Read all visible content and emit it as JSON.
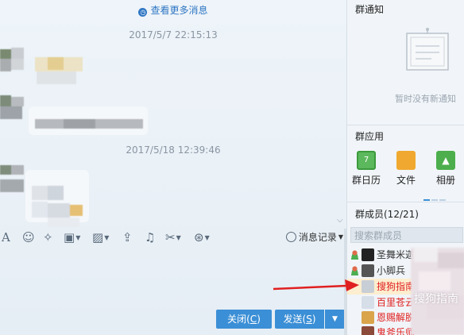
{
  "chat": {
    "view_more": "查看更多消息",
    "timestamps": [
      "2017/5/7 22:15:13",
      "2017/5/18 12:39:46"
    ]
  },
  "toolbar": {
    "font_icon": "A",
    "history_label": "消息记录"
  },
  "buttons": {
    "close_label": "关闭(",
    "close_key": "C",
    "close_end": ")",
    "send_label": "发送(",
    "send_key": "S",
    "send_end": ")"
  },
  "side": {
    "notice_title": "群通知",
    "notice_empty": "暂时没有新通知",
    "apps_title": "群应用",
    "apps": [
      {
        "label": "群日历",
        "icon": "calendar-icon",
        "color": "#5cb85c"
      },
      {
        "label": "文件",
        "icon": "folder-icon",
        "color": "#f0a830"
      },
      {
        "label": "相册",
        "icon": "album-icon",
        "color": "#4cae4c"
      }
    ],
    "members_title": "群成员(12/21)",
    "search_placeholder": "搜索群成员",
    "members": [
      {
        "name": "圣舞米迦",
        "color": "#222222",
        "role": "admin"
      },
      {
        "name": "小脚兵",
        "color": "#222222",
        "role": "admin"
      },
      {
        "name": "搜狗指南",
        "color": "#e02020",
        "role": "none"
      },
      {
        "name": "百里苍云",
        "color": "#e02020",
        "role": "none"
      },
      {
        "name": "恩赐解脱",
        "color": "#e02020",
        "role": "none"
      },
      {
        "name": "鬼斧乐师",
        "color": "#e02020",
        "role": "none"
      }
    ]
  },
  "watermark": "搜狗指南",
  "colors": {
    "accent": "#3b8fd6",
    "link": "#2f76c4"
  }
}
